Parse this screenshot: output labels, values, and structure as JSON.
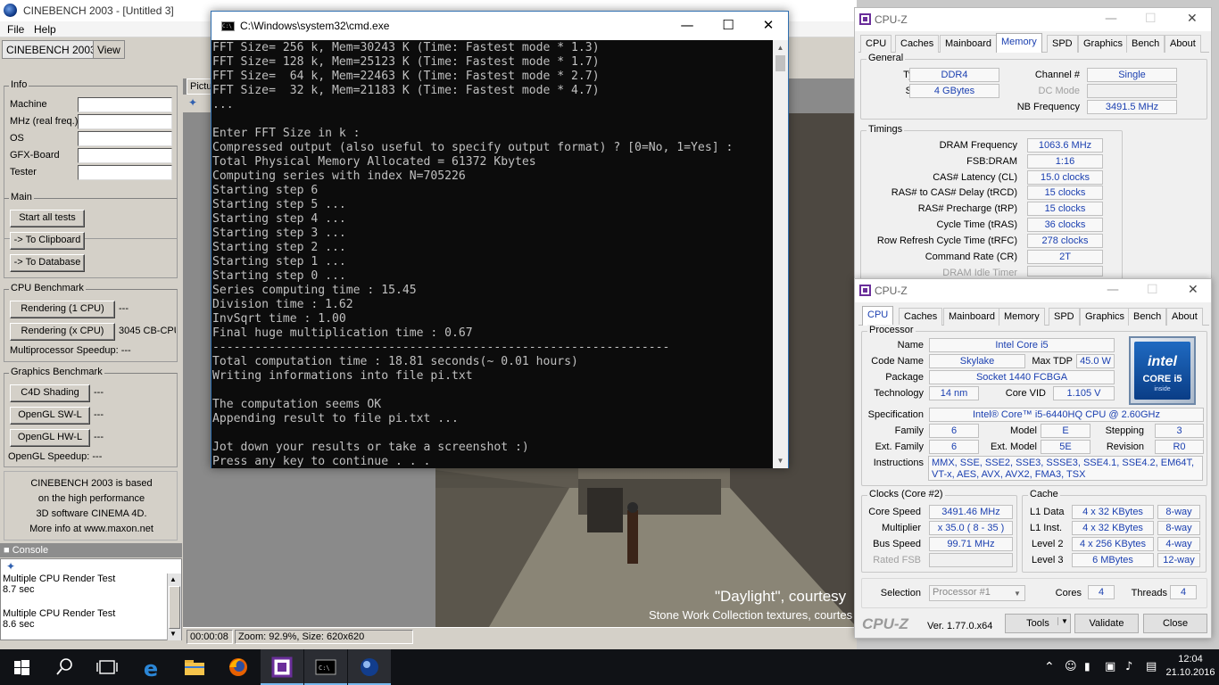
{
  "cinebench": {
    "title": "CINEBENCH 2003 - [Untitled 3]",
    "menu": [
      "File",
      "Help"
    ],
    "tabs": [
      "CINEBENCH 2003",
      "View"
    ],
    "info": {
      "label": "Info",
      "fields": [
        "Machine",
        "MHz (real freq.)",
        "OS",
        "GFX-Board",
        "Tester"
      ]
    },
    "main": {
      "label": "Main",
      "buttons": [
        "Start all tests",
        "-> To Clipboard",
        "-> To Database"
      ]
    },
    "cpu_benchmark": {
      "label": "CPU Benchmark",
      "rendering1": "Rendering (1 CPU)",
      "rendering1_result": "---",
      "renderingx": "Rendering (x CPU)",
      "renderingx_result": "3045 CB-CPU",
      "speedup": "Multiprocessor Speedup:  ---"
    },
    "graphics_benchmark": {
      "label": "Graphics Benchmark",
      "c4d": "C4D Shading",
      "c4d_result": "---",
      "sw": "OpenGL SW-L",
      "sw_result": "---",
      "hw": "OpenGL HW-L",
      "hw_result": "---",
      "speedup": "OpenGL Speedup:  ---"
    },
    "about": [
      "CINEBENCH 2003 is based",
      "on the high performance",
      "3D software CINEMA 4D.",
      "More info at www.maxon.net"
    ],
    "console": {
      "label": "Console",
      "lines": [
        "Multiple CPU Render Test",
        "8.7 sec",
        "Multiple CPU Render Test",
        "8.6 sec"
      ]
    },
    "picture_tab": "Picture",
    "render_caption1": "\"Daylight\", courtesy",
    "render_caption2": "Stone Work Collection textures, courtes",
    "status_time": "00:00:08",
    "status_zoom": "Zoom: 92.9%, Size: 620x620"
  },
  "cmd": {
    "title": "C:\\Windows\\system32\\cmd.exe",
    "lines": [
      "FFT Size= 256 k, Mem=30243 K (Time: Fastest mode * 1.3)",
      "FFT Size= 128 k, Mem=25123 K (Time: Fastest mode * 1.7)",
      "FFT Size=  64 k, Mem=22463 K (Time: Fastest mode * 2.7)",
      "FFT Size=  32 k, Mem=21183 K (Time: Fastest mode * 4.7)",
      "...",
      "",
      "Enter FFT Size in k :",
      "Compressed output (also useful to specify output format) ? [0=No, 1=Yes] :",
      "Total Physical Memory Allocated = 61372 Kbytes",
      "Computing series with index N=705226",
      "Starting step 6",
      "Starting step 5 ...",
      "Starting step 4 ...",
      "Starting step 3 ...",
      "Starting step 2 ...",
      "Starting step 1 ...",
      "Starting step 0 ...",
      "Series computing time : 15.45",
      "Division time : 1.62",
      "InvSqrt time : 1.00",
      "Final huge multiplication time : 0.67",
      "-----------------------------------------------------------------",
      "Total computation time : 18.81 seconds(~ 0.01 hours)",
      "Writing informations into file pi.txt",
      "",
      "The computation seems OK",
      "Appending result to file pi.txt ...",
      "",
      "Jot down your results or take a screenshot :)",
      "Press any key to continue . . ."
    ]
  },
  "cpuz_memory": {
    "title": "CPU-Z",
    "tabs": [
      "CPU",
      "Caches",
      "Mainboard",
      "Memory",
      "SPD",
      "Graphics",
      "Bench",
      "About"
    ],
    "selected_tab": "Memory",
    "general_label": "General",
    "type_label": "Type",
    "type": "DDR4",
    "size_label": "Size",
    "size": "4 GBytes",
    "channel_label": "Channel #",
    "channel": "Single",
    "dcmode_label": "DC Mode",
    "nbfreq_label": "NB Frequency",
    "nbfreq": "3491.5 MHz",
    "timings_label": "Timings",
    "timings": [
      {
        "label": "DRAM Frequency",
        "value": "1063.6 MHz"
      },
      {
        "label": "FSB:DRAM",
        "value": "1:16"
      },
      {
        "label": "CAS# Latency (CL)",
        "value": "15.0 clocks"
      },
      {
        "label": "RAS# to CAS# Delay (tRCD)",
        "value": "15 clocks"
      },
      {
        "label": "RAS# Precharge (tRP)",
        "value": "15 clocks"
      },
      {
        "label": "Cycle Time (tRAS)",
        "value": "36 clocks"
      },
      {
        "label": "Row Refresh Cycle Time (tRFC)",
        "value": "278 clocks"
      },
      {
        "label": "Command Rate (CR)",
        "value": "2T"
      },
      {
        "label": "DRAM Idle Timer",
        "value": ""
      }
    ]
  },
  "cpuz_cpu": {
    "title": "CPU-Z",
    "tabs": [
      "CPU",
      "Caches",
      "Mainboard",
      "Memory",
      "SPD",
      "Graphics",
      "Bench",
      "About"
    ],
    "selected_tab": "CPU",
    "processor_label": "Processor",
    "name_label": "Name",
    "name": "Intel Core i5",
    "codename_label": "Code Name",
    "codename": "Skylake",
    "maxtdp_label": "Max TDP",
    "maxtdp": "45.0 W",
    "package_label": "Package",
    "package": "Socket 1440 FCBGA",
    "technology_label": "Technology",
    "technology": "14 nm",
    "corevid_label": "Core VID",
    "corevid": "1.105 V",
    "spec_label": "Specification",
    "spec": "Intel® Core™ i5-6440HQ CPU @ 2.60GHz",
    "family_label": "Family",
    "family": "6",
    "model_label": "Model",
    "model": "E",
    "stepping_label": "Stepping",
    "stepping": "3",
    "extfamily_label": "Ext. Family",
    "extfamily": "6",
    "extmodel_label": "Ext. Model",
    "extmodel": "5E",
    "revision_label": "Revision",
    "revision": "R0",
    "instructions_label": "Instructions",
    "instructions": "MMX, SSE, SSE2, SSE3, SSSE3, SSE4.1, SSE4.2, EM64T, VT-x, AES, AVX, AVX2, FMA3, TSX",
    "logo_brand": "intel",
    "logo_line": "CORE i5",
    "logo_sub": "inside",
    "clocks_label": "Clocks (Core #2)",
    "corespeed_label": "Core Speed",
    "corespeed": "3491.46 MHz",
    "multiplier_label": "Multiplier",
    "multiplier": "x 35.0 ( 8 - 35 )",
    "busspeed_label": "Bus Speed",
    "busspeed": "99.71 MHz",
    "ratedfsb_label": "Rated FSB",
    "cache_label": "Cache",
    "cache": [
      {
        "label": "L1 Data",
        "size": "4 x 32 KBytes",
        "way": "8-way"
      },
      {
        "label": "L1 Inst.",
        "size": "4 x 32 KBytes",
        "way": "8-way"
      },
      {
        "label": "Level 2",
        "size": "4 x 256 KBytes",
        "way": "4-way"
      },
      {
        "label": "Level 3",
        "size": "6 MBytes",
        "way": "12-way"
      }
    ],
    "selection_label": "Selection",
    "selection": "Processor #1",
    "cores_label": "Cores",
    "cores": "4",
    "threads_label": "Threads",
    "threads": "4",
    "brand": "CPU-Z",
    "version": "Ver. 1.77.0.x64",
    "tools_button": "Tools",
    "validate_button": "Validate",
    "close_button": "Close"
  },
  "taskbar": {
    "time": "12:04",
    "date": "21.10.2016",
    "apps": [
      "start-icon",
      "search-icon",
      "task-view-icon",
      "edge-icon",
      "file-explorer-icon",
      "firefox-icon",
      "cpuz-icon",
      "cmd-icon",
      "cinebench-icon"
    ]
  }
}
